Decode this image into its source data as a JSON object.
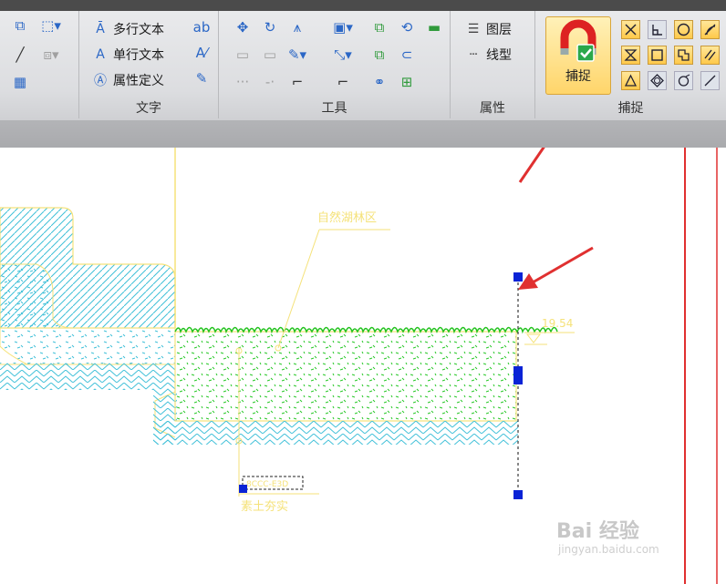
{
  "ribbon": {
    "text_panel": {
      "label": "文字",
      "items": [
        {
          "label": "多行文本",
          "icon": "multiline-text-icon"
        },
        {
          "label": "单行文本",
          "icon": "single-line-text-icon"
        },
        {
          "label": "属性定义",
          "icon": "attribute-definition-icon"
        }
      ]
    },
    "tools_panel": {
      "label": "工具"
    },
    "properties_panel": {
      "label": "属性",
      "items": [
        {
          "label": "图层",
          "icon": "layers-icon"
        },
        {
          "label": "线型",
          "icon": "linetype-icon"
        }
      ]
    },
    "snap_panel": {
      "label": "捕捉",
      "capture_button": "捕捉"
    }
  },
  "drawing": {
    "area_label": "自然湖林区",
    "elevation_value": "19.54",
    "bottom_label": "素土夯实",
    "boxed_label": "8CCC-E3D"
  },
  "watermark": {
    "brand": "Bai 经验",
    "url": "jingyan.baidu.com"
  },
  "colors": {
    "cad_yellow": "#f5e27a",
    "hatch_cyan": "#3fc0d8",
    "grass_green": "#22c21d",
    "grip_blue": "#0a23d6",
    "annotation_red": "#e03030"
  }
}
